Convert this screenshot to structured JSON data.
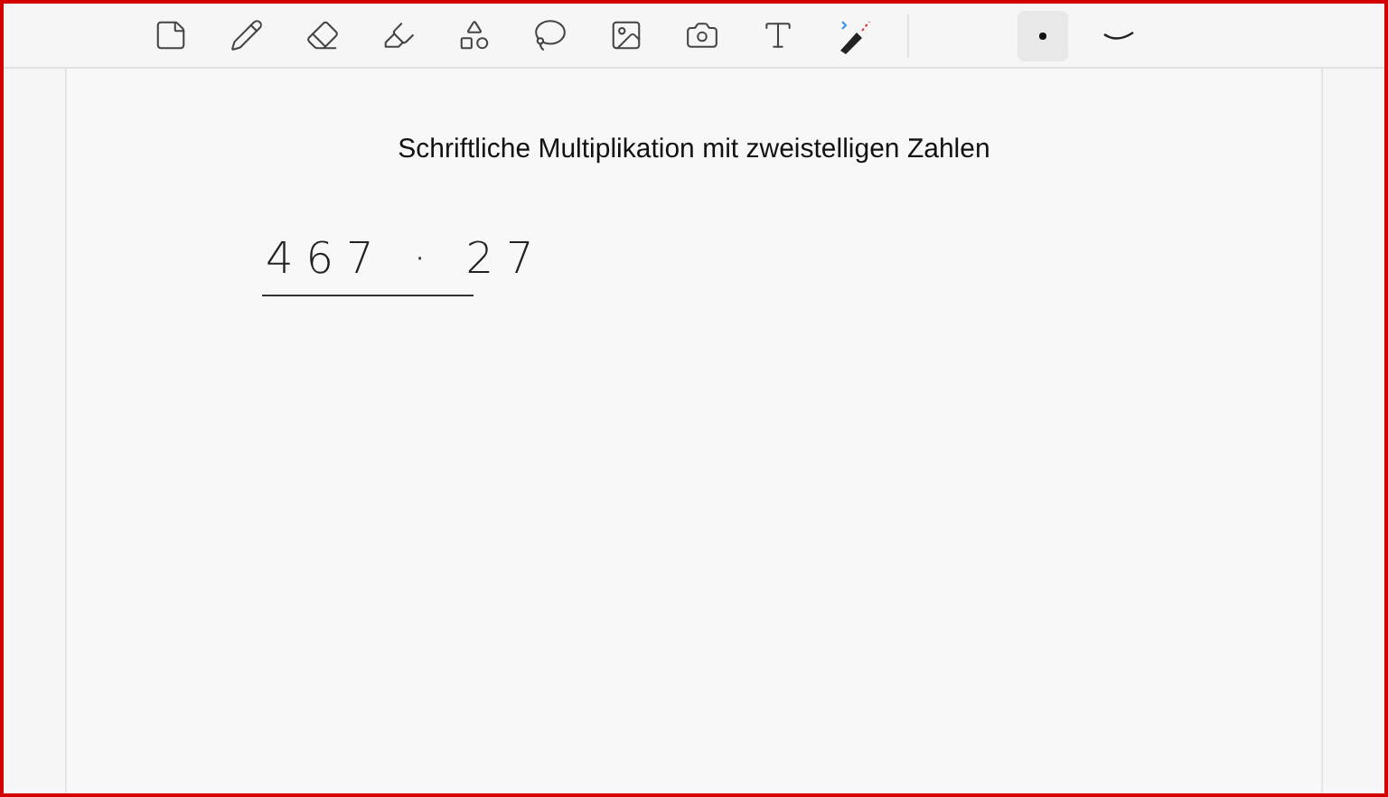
{
  "toolbar": {
    "tools": [
      {
        "kind": "page",
        "selected": false
      },
      {
        "kind": "pen",
        "selected": false
      },
      {
        "kind": "eraser",
        "selected": false
      },
      {
        "kind": "highlighter",
        "selected": false
      },
      {
        "kind": "shapes",
        "selected": false
      },
      {
        "kind": "lasso",
        "selected": false
      },
      {
        "kind": "image",
        "selected": false
      },
      {
        "kind": "camera",
        "selected": false
      },
      {
        "kind": "text",
        "selected": false
      },
      {
        "kind": "stylus",
        "selected": false
      }
    ],
    "options": [
      {
        "kind": "dot",
        "selected": true
      },
      {
        "kind": "stroke",
        "selected": false
      }
    ]
  },
  "page": {
    "title": "Schriftliche Multiplikation mit zweistelligen Zahlen",
    "handwriting": "467 · 27"
  }
}
